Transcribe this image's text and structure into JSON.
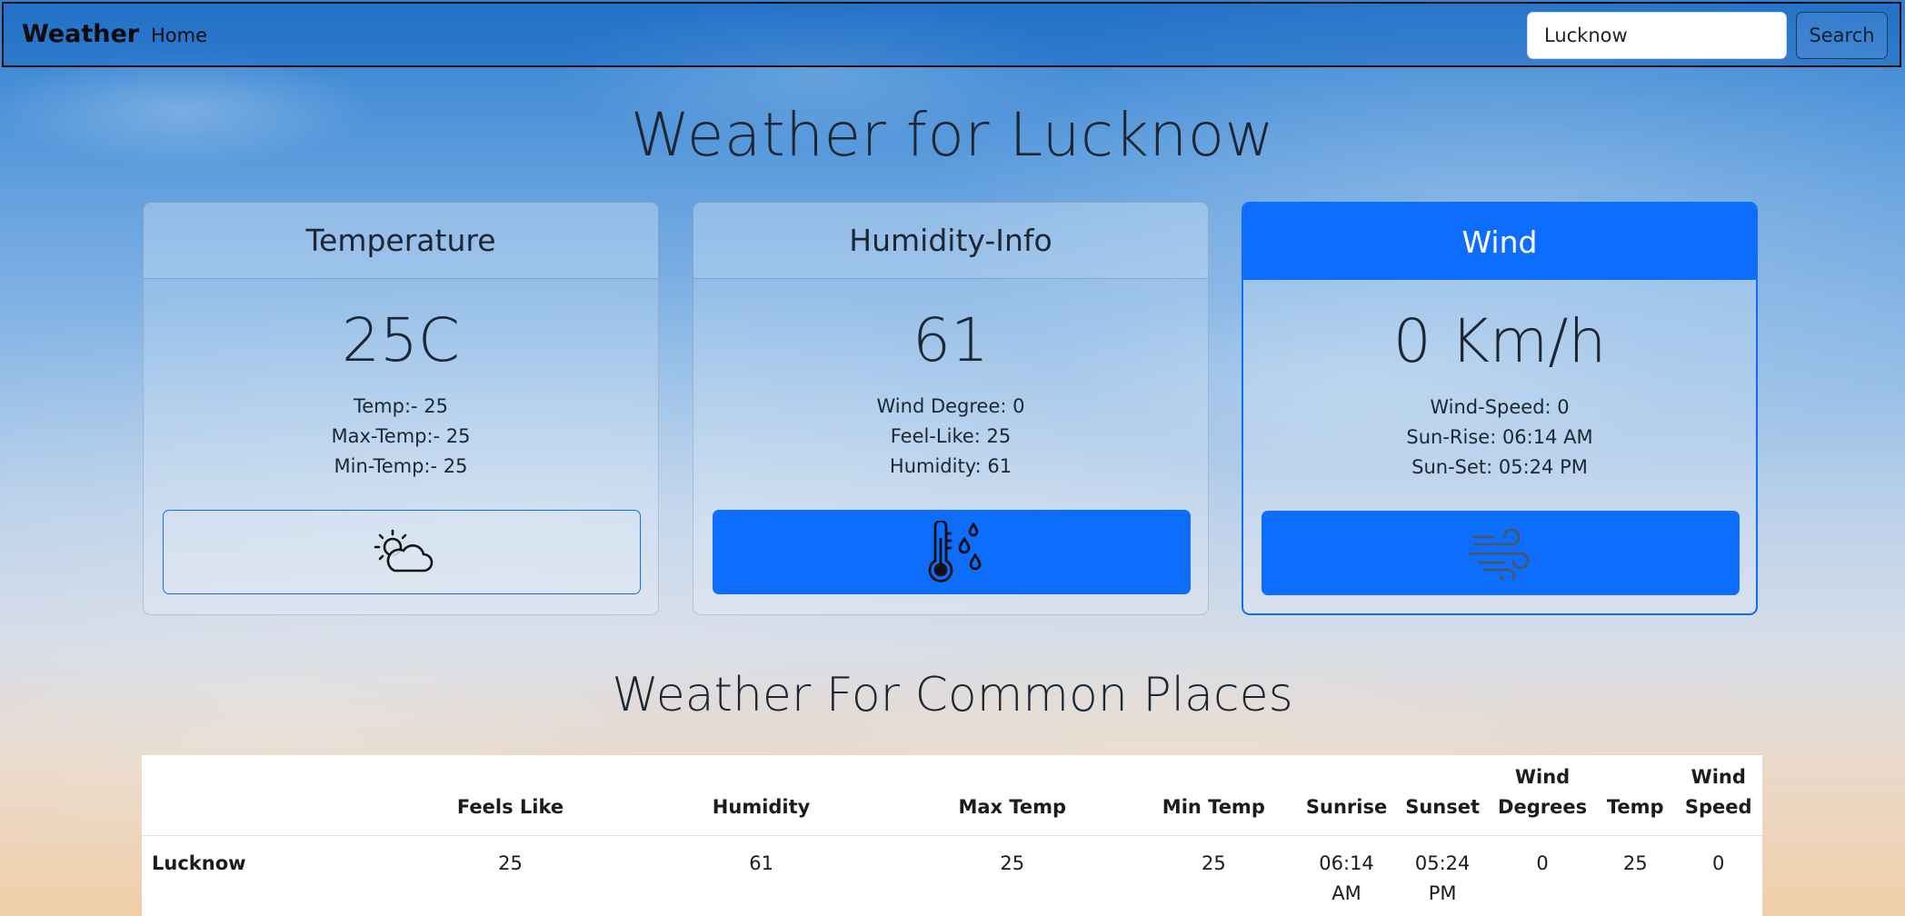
{
  "nav": {
    "brand": "Weather",
    "home": "Home",
    "search_value": "Lucknow",
    "search_button": "Search"
  },
  "page_title": "Weather for Lucknow",
  "cards": {
    "temperature": {
      "header": "Temperature",
      "value": "25C",
      "lines": [
        "Temp:- 25",
        "Max-Temp:- 25",
        "Min-Temp:- 25"
      ],
      "icon": "partly-cloudy-icon"
    },
    "humidity": {
      "header": "Humidity-Info",
      "value": "61",
      "lines": [
        "Wind Degree: 0",
        "Feel-Like: 25",
        "Humidity: 61"
      ],
      "icon": "thermometer-drops-icon"
    },
    "wind": {
      "header": "Wind",
      "value": "0 Km/h",
      "lines": [
        "Wind-Speed: 0",
        "Sun-Rise: 06:14 AM",
        "Sun-Set: 05:24 PM"
      ],
      "icon": "wind-icon"
    }
  },
  "section_title": "Weather For Common Places",
  "table": {
    "headers": [
      "",
      "Feels Like",
      "Humidity",
      "Max Temp",
      "Min Temp",
      "Sunrise",
      "Sunset",
      "Wind Degrees",
      "Temp",
      "Wind Speed"
    ],
    "rows": [
      [
        "Lucknow",
        "25",
        "61",
        "25",
        "25",
        "06:14 AM",
        "05:24 PM",
        "0",
        "25",
        "0"
      ]
    ]
  },
  "colors": {
    "primary": "#0d6efd",
    "text": "#1c2733"
  }
}
